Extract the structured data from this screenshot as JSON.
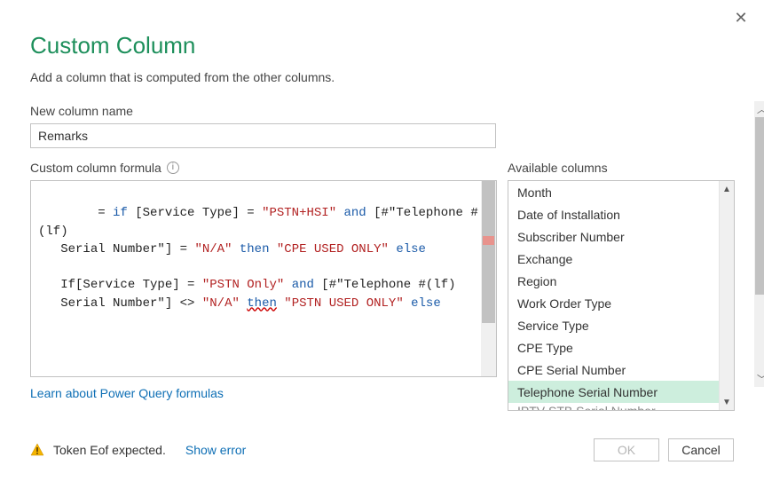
{
  "dialog": {
    "title": "Custom Column",
    "subtitle": "Add a column that is computed from the other columns.",
    "close_glyph": "✕"
  },
  "column_name": {
    "label": "New column name",
    "value": "Remarks"
  },
  "formula": {
    "label": "Custom column formula",
    "tokens": [
      {
        "t": "= ",
        "c": ""
      },
      {
        "t": "if",
        "c": "kw-blue"
      },
      {
        "t": " [Service Type] = ",
        "c": ""
      },
      {
        "t": "\"PSTN+HSI\"",
        "c": "kw-red"
      },
      {
        "t": " ",
        "c": ""
      },
      {
        "t": "and",
        "c": "kw-blue"
      },
      {
        "t": " [#\"Telephone #(lf)\n   Serial Number\"] = ",
        "c": ""
      },
      {
        "t": "\"N/A\"",
        "c": "kw-red"
      },
      {
        "t": " ",
        "c": ""
      },
      {
        "t": "then",
        "c": "kw-blue"
      },
      {
        "t": " ",
        "c": ""
      },
      {
        "t": "\"CPE USED ONLY\"",
        "c": "kw-red"
      },
      {
        "t": " ",
        "c": ""
      },
      {
        "t": "else",
        "c": "kw-blue"
      },
      {
        "t": "\n\n   If[Service Type] = ",
        "c": ""
      },
      {
        "t": "\"PSTN Only\"",
        "c": "kw-red"
      },
      {
        "t": " ",
        "c": ""
      },
      {
        "t": "and",
        "c": "kw-blue"
      },
      {
        "t": " [#\"Telephone #(lf)\n   Serial Number\"] <> ",
        "c": ""
      },
      {
        "t": "\"N/A\"",
        "c": "kw-red"
      },
      {
        "t": " ",
        "c": ""
      },
      {
        "t": "then",
        "c": "kw-blue wavy"
      },
      {
        "t": " ",
        "c": ""
      },
      {
        "t": "\"PSTN USED ONLY\"",
        "c": "kw-red"
      },
      {
        "t": " ",
        "c": ""
      },
      {
        "t": "else",
        "c": "kw-blue"
      }
    ],
    "learn_link": "Learn about Power Query formulas"
  },
  "available": {
    "label": "Available columns",
    "items": [
      {
        "label": "Month",
        "selected": false
      },
      {
        "label": "Date of Installation",
        "selected": false
      },
      {
        "label": "Subscriber Number",
        "selected": false
      },
      {
        "label": "Exchange",
        "selected": false
      },
      {
        "label": "Region",
        "selected": false
      },
      {
        "label": "Work Order Type",
        "selected": false
      },
      {
        "label": "Service Type",
        "selected": false
      },
      {
        "label": "CPE Type",
        "selected": false
      },
      {
        "label": "CPE Serial Number",
        "selected": false
      },
      {
        "label": "Telephone Serial Number",
        "selected": true
      },
      {
        "label": "IPTV STB Serial Number",
        "selected": false,
        "cutoff": true
      }
    ]
  },
  "status": {
    "message": "Token Eof expected.",
    "show_error": "Show error"
  },
  "buttons": {
    "ok": "OK",
    "cancel": "Cancel"
  }
}
